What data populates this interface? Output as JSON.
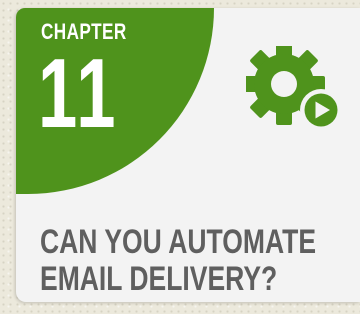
{
  "badge": {
    "label": "CHAPTER",
    "number": "11"
  },
  "title": {
    "line1": "CAN YOU AUTOMATE",
    "line2": "EMAIL DELIVERY?"
  },
  "icon": "gear-with-play-icon",
  "colors": {
    "accent": "#4f931c",
    "title_text": "#5f5f5f",
    "card_background": "#f3f3f3",
    "page_background": "#ece9dc"
  }
}
